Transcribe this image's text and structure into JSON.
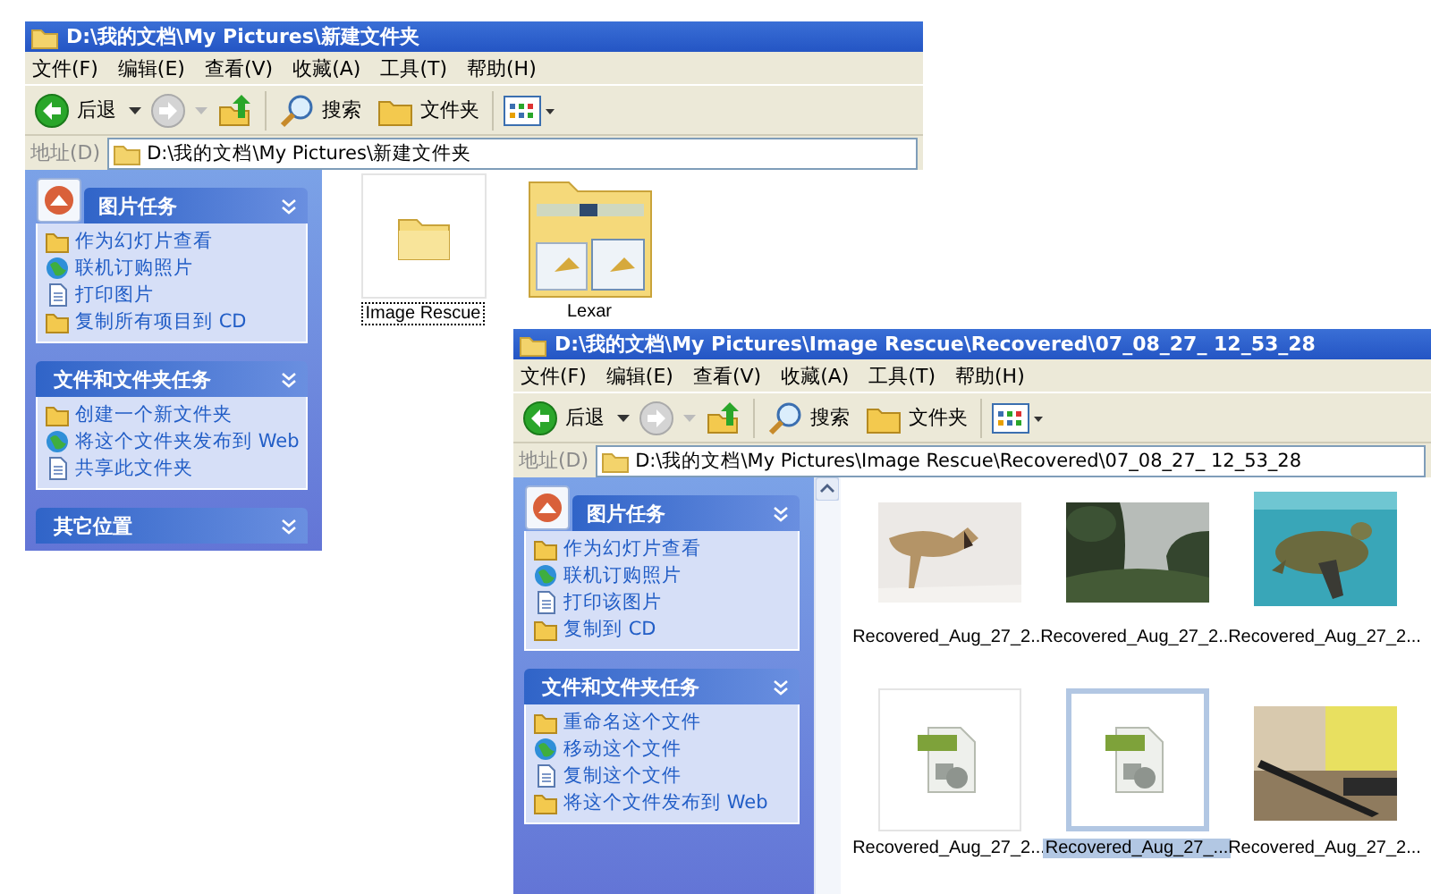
{
  "windows": [
    {
      "title": "D:\\我的文档\\My Pictures\\新建文件夹",
      "menu": [
        "文件(F)",
        "编辑(E)",
        "查看(V)",
        "收藏(A)",
        "工具(T)",
        "帮助(H)"
      ],
      "toolbar": {
        "back": "后退",
        "search": "搜索",
        "folders": "文件夹"
      },
      "address": {
        "label": "地址(D)",
        "path": "D:\\我的文档\\My Pictures\\新建文件夹"
      },
      "pane_scrollbar": false,
      "task_groups": [
        {
          "title": "图片任务",
          "kind": "picture",
          "items": [
            "作为幻灯片查看",
            "联机订购照片",
            "打印图片",
            "复制所有项目到 CD"
          ]
        },
        {
          "title": "文件和文件夹任务",
          "kind": "plain",
          "items": [
            "创建一个新文件夹",
            "将这个文件夹发布到 Web",
            "共享此文件夹"
          ]
        },
        {
          "title": "其它位置",
          "kind": "plain"
        }
      ],
      "files": [
        {
          "name": "Image Rescue",
          "kind": "folder",
          "selected": true
        },
        {
          "name": "Lexar",
          "kind": "folder-preview",
          "selected": false
        }
      ]
    },
    {
      "title": "D:\\我的文档\\My Pictures\\Image Rescue\\Recovered\\07_08_27_ 12_53_28",
      "menu": [
        "文件(F)",
        "编辑(E)",
        "查看(V)",
        "收藏(A)",
        "工具(T)",
        "帮助(H)"
      ],
      "toolbar": {
        "back": "后退",
        "search": "搜索",
        "folders": "文件夹"
      },
      "address": {
        "label": "地址(D)",
        "path": "D:\\我的文档\\My Pictures\\Image Rescue\\Recovered\\07_08_27_ 12_53_28"
      },
      "pane_scrollbar": true,
      "task_groups": [
        {
          "title": "图片任务",
          "kind": "picture",
          "items": [
            "作为幻灯片查看",
            "联机订购照片",
            "打印该图片",
            "复制到 CD"
          ]
        },
        {
          "title": "文件和文件夹任务",
          "kind": "plain",
          "items": [
            "重命名这个文件",
            "移动这个文件",
            "复制这个文件",
            "将这个文件发布到 Web"
          ]
        }
      ],
      "files": [
        {
          "name": "Recovered_Aug_27_2...",
          "kind": "picture",
          "selected": false
        },
        {
          "name": "Recovered_Aug_27_2...",
          "kind": "picture",
          "selected": false
        },
        {
          "name": "Recovered_Aug_27_2...",
          "kind": "picture",
          "selected": false
        },
        {
          "name": "Recovered_Aug_27_2...",
          "kind": "tiff",
          "selected": false
        },
        {
          "name": "Recovered_Aug_27_...",
          "kind": "tiff",
          "selected": true
        },
        {
          "name": "Recovered_Aug_27_2...",
          "kind": "picture",
          "selected": false
        }
      ]
    }
  ]
}
